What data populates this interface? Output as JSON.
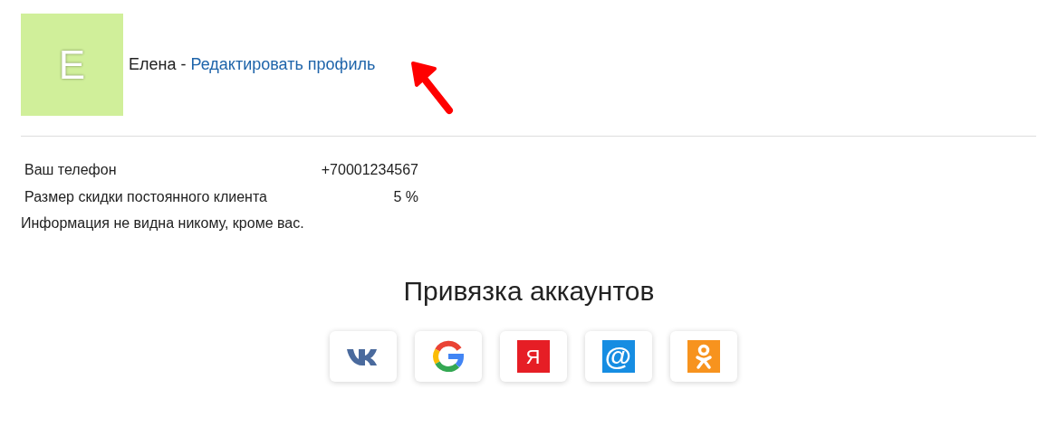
{
  "profile": {
    "avatar_letter": "E",
    "name": "Елена",
    "separator": "-",
    "edit_link": "Редактировать профиль"
  },
  "info_rows": [
    {
      "label": "Ваш телефон",
      "value": "+70001234567"
    },
    {
      "label": "Размер скидки постоянного клиента",
      "value": "5 %"
    }
  ],
  "privacy_note": "Информация не видна никому, кроме вас.",
  "linking": {
    "title": "Привязка аккаунтов",
    "providers": [
      {
        "kind": "vk"
      },
      {
        "kind": "google"
      },
      {
        "kind": "yandex",
        "glyph": "Я"
      },
      {
        "kind": "mail",
        "glyph": "@"
      },
      {
        "kind": "ok"
      }
    ]
  }
}
